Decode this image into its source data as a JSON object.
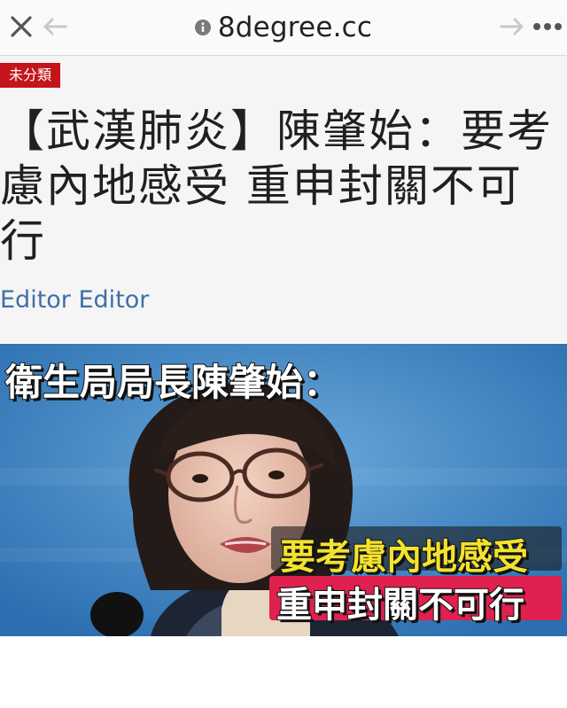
{
  "browser": {
    "url": "8degree.cc",
    "close_icon": "close-icon",
    "back_icon": "arrow-left-icon",
    "forward_icon": "arrow-right-icon",
    "more_icon": "more-dots-icon",
    "info_icon": "info-icon"
  },
  "article": {
    "category": "未分類",
    "title": "【武漢肺炎】陳肇始：要考慮內地感受 重申封關不可行",
    "author": "Editor Editor"
  },
  "hero_image": {
    "caption_top": "衛生局局長陳肇始：",
    "caption_line1": "要考慮內地感受",
    "caption_line2": "重申封關不可行"
  },
  "colors": {
    "category_bg": "#c3151b",
    "author": "#3f6fa8",
    "caption_yellow": "#f3e22e",
    "caption_red": "#e0204e"
  }
}
